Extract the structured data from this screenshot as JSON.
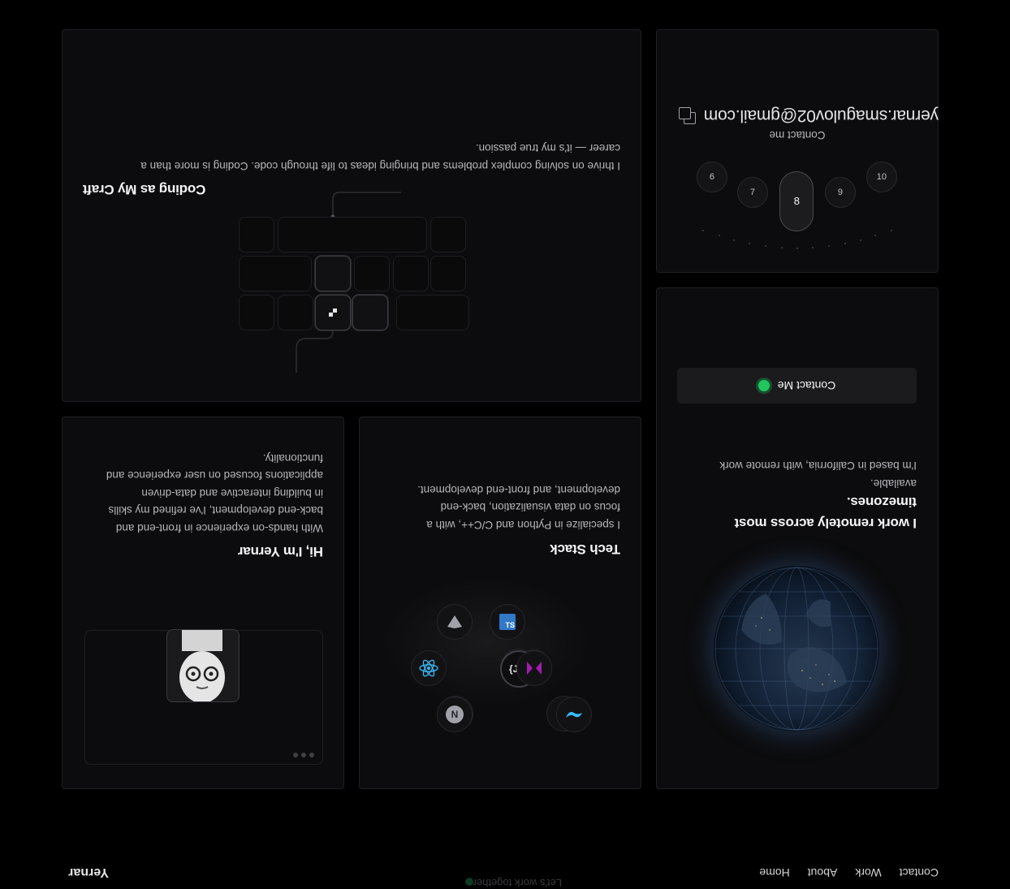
{
  "nav": {
    "logo": "Yernar",
    "links": [
      "Home",
      "About",
      "Work",
      "Contact"
    ],
    "ghost_cta": "Let's work together"
  },
  "coding_card": {
    "title": "Coding as My Craft",
    "line1": "I thrive on solving complex problems and bringing ideas to life through code. Coding is more than a",
    "line2": "career — it's my true passion."
  },
  "contact_card": {
    "email": "yernar.smagulov02@gmail.com",
    "label": "Contact me",
    "picker": [
      "6",
      "7",
      "8",
      "9",
      "10"
    ]
  },
  "location_card": {
    "title_line1": "I work remotely across most",
    "title_line2": "timezones.",
    "text_line1": "I'm based in California, with remote work",
    "text_line2": "available.",
    "button": "Contact Me",
    "accent": "#22c55e"
  },
  "intro_card": {
    "title": "Hi, I'm Yernar",
    "lines": [
      "With hands-on experience in front-end and",
      "back-end development, I've refined my skills",
      "in building interactive and data-driven",
      "applications focused on user experience and",
      "functionality."
    ]
  },
  "tech_card": {
    "title": "Tech Stack",
    "lines": [
      "I specialize in Python and C/C++, with a",
      "focus on data visualization, back-end",
      "development, and front-end development."
    ],
    "center_label": "{JS}",
    "icons": [
      "vite-icon",
      "typescript-icon",
      "react-icon",
      "mapbox-icon",
      "nextjs-icon",
      "tailwind-icon"
    ],
    "ts_text": "TS"
  }
}
